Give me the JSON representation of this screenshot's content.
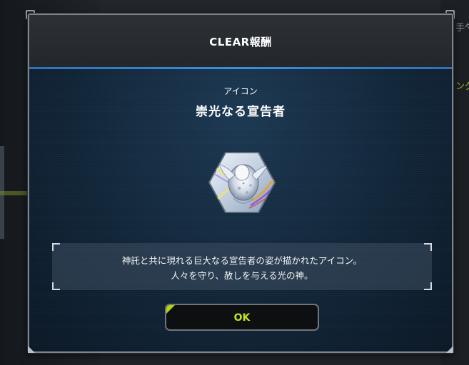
{
  "background": {
    "right_label_top": "手勺",
    "right_label_mid": "ング"
  },
  "dialog": {
    "title": "CLEAR報酬",
    "reward": {
      "category": "アイコン",
      "name": "崇光なる宣告者",
      "icon": "hexagon-monster-icon",
      "description_lines": [
        "神託と共に現れる巨大なる宣告者の姿が描かれたアイコン。",
        "人々を守り、赦しを与える光の神。"
      ]
    },
    "ok_button": {
      "label": "OK",
      "accent_color": "#b4d414",
      "text_color": "#c6e21b"
    },
    "header_rule_color": "#3d8fdb"
  }
}
